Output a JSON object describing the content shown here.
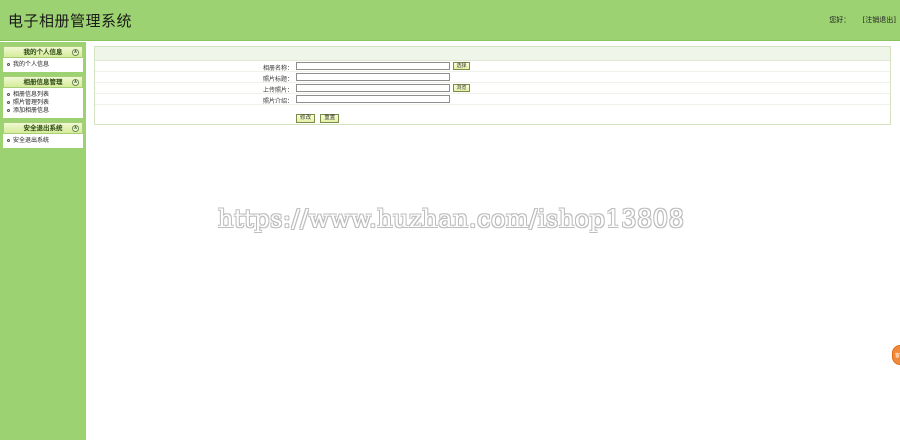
{
  "header": {
    "title": "电子相册管理系统",
    "greeting": "您好：",
    "logout_label": "[注销退出]"
  },
  "sidebar": {
    "groups": [
      {
        "title": "我的个人信息",
        "toggle": "∧",
        "items": [
          "我的个人信息"
        ]
      },
      {
        "title": "相册信息管理",
        "toggle": "∧",
        "items": [
          "相册信息列表",
          "照片管理列表",
          "添加相册信息"
        ]
      },
      {
        "title": "安全退出系统",
        "toggle": "∧",
        "items": [
          "安全退出系统"
        ]
      }
    ]
  },
  "form": {
    "fields": [
      {
        "label": "相册名称：",
        "value": "",
        "button": "选择"
      },
      {
        "label": "照片标题：",
        "value": ""
      },
      {
        "label": "上传照片：",
        "value": "",
        "button": "浏览"
      },
      {
        "label": "照片介绍：",
        "value": ""
      }
    ],
    "submit_label": "修改",
    "reset_label": "重置"
  },
  "watermark": "https://www.huzhan.com/ishop13808",
  "float_widget": {
    "label": "客服"
  },
  "colors": {
    "header_bg": "#9cd271",
    "sidebar_bg": "#9cd271",
    "form_top_bg": "#eff5e8",
    "button_bg": "#e4f0a6",
    "widget_bg": "#f08a3a"
  }
}
